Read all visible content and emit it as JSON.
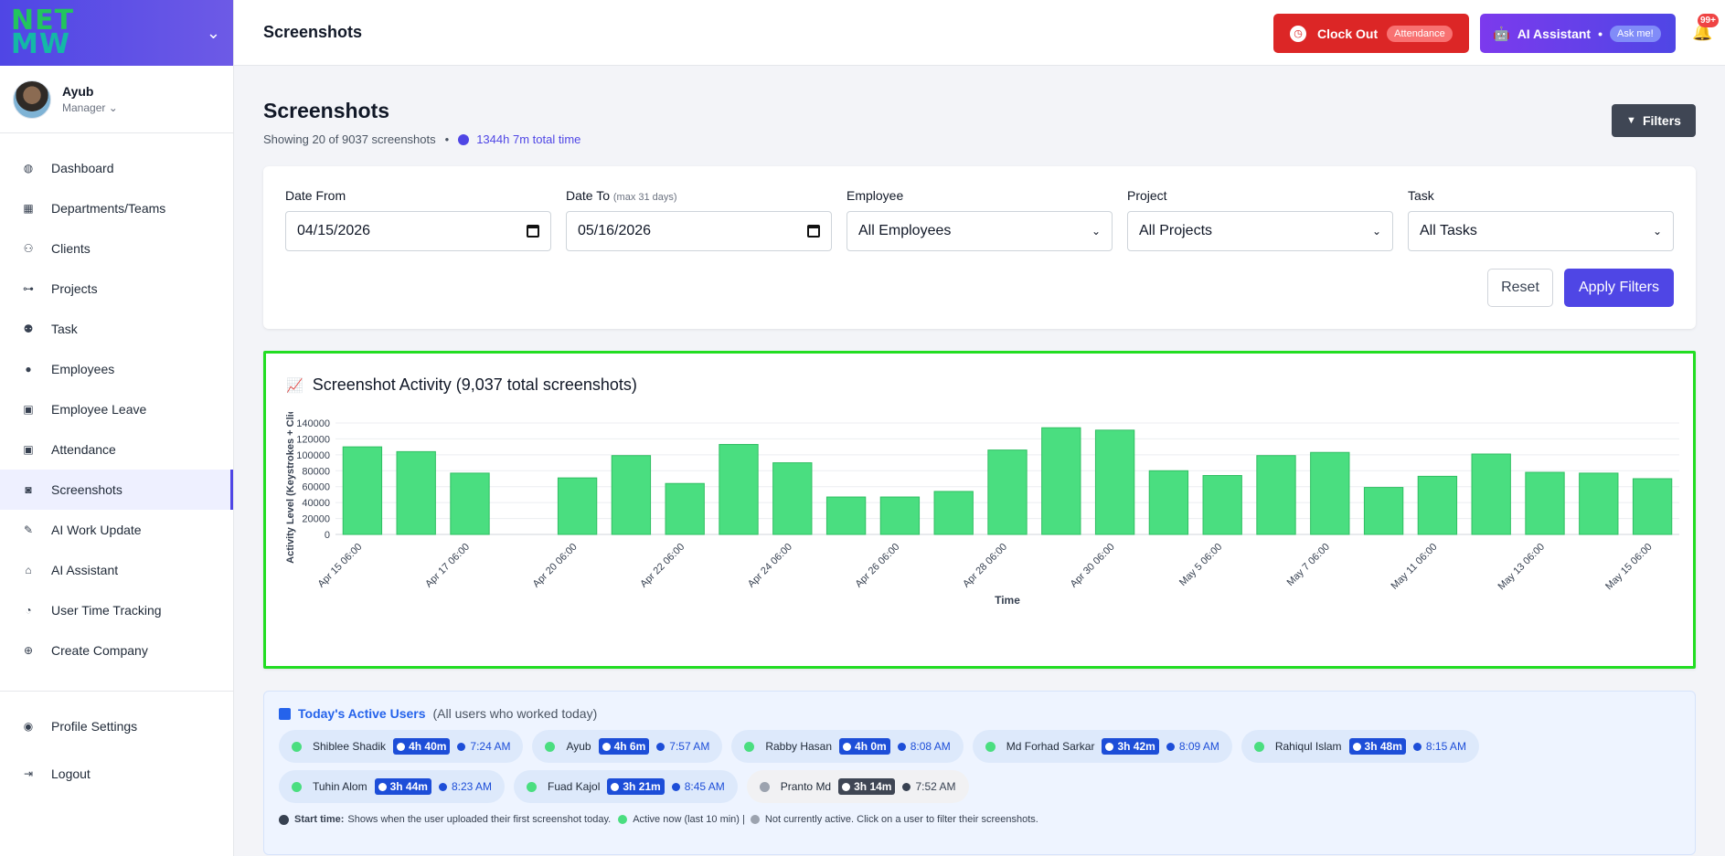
{
  "brand": {
    "logo_line1": "NET",
    "logo_line2": "MW"
  },
  "user": {
    "name": "Ayub",
    "role": "Manager"
  },
  "nav": [
    {
      "label": "Dashboard",
      "icon": "dashboard-icon"
    },
    {
      "label": "Departments/Teams",
      "icon": "building-icon"
    },
    {
      "label": "Clients",
      "icon": "users-icon"
    },
    {
      "label": "Projects",
      "icon": "project-diagram-icon"
    },
    {
      "label": "Task",
      "icon": "people-group-icon"
    },
    {
      "label": "Employees",
      "icon": "user-icon"
    },
    {
      "label": "Employee Leave",
      "icon": "calendar-x-icon"
    },
    {
      "label": "Attendance",
      "icon": "calendar-check-icon"
    },
    {
      "label": "Screenshots",
      "icon": "camera-icon"
    },
    {
      "label": "AI Work Update",
      "icon": "pen-icon"
    },
    {
      "label": "AI Assistant",
      "icon": "robot-icon"
    },
    {
      "label": "User Time Tracking",
      "icon": "user-clock-icon"
    },
    {
      "label": "Create Company",
      "icon": "plus-circle-icon"
    }
  ],
  "nav_bottom": [
    {
      "label": "Profile Settings",
      "icon": "user-circle-icon"
    },
    {
      "label": "Logout",
      "icon": "logout-icon"
    }
  ],
  "topbar": {
    "title": "Screenshots",
    "clock_out": "Clock Out",
    "clock_out_pill": "Attendance",
    "ai_assistant": "AI Assistant",
    "ai_dot": "•",
    "ai_pill": "Ask me!",
    "notification_count": "99+"
  },
  "page": {
    "title": "Screenshots",
    "showing": "Showing 20 of 9037 screenshots",
    "dot": "•",
    "total_time": "1344h 7m total time",
    "filters_button": "Filters"
  },
  "filters": {
    "date_from_label": "Date From",
    "date_from_value": "04/15/2026",
    "date_to_label": "Date To",
    "date_to_hint": "(max 31 days)",
    "date_to_value": "05/16/2026",
    "employee_label": "Employee",
    "employee_value": "All Employees",
    "project_label": "Project",
    "project_value": "All Projects",
    "task_label": "Task",
    "task_value": "All Tasks",
    "reset": "Reset",
    "apply": "Apply Filters"
  },
  "chart_data": {
    "type": "bar",
    "title": "Screenshot Activity (9,037 total screenshots)",
    "xlabel": "Time",
    "ylabel": "Activity Level (Keystrokes + Clic",
    "ylim": [
      0,
      140000
    ],
    "yticks": [
      0,
      20000,
      40000,
      60000,
      80000,
      100000,
      120000,
      140000
    ],
    "bar_color": "#4ade80",
    "categories": [
      "Apr 15 06:00",
      "Apr 16 06:00",
      "Apr 17 06:00",
      "Apr 19 06:00",
      "Apr 20 06:00",
      "Apr 21 06:00",
      "Apr 22 06:00",
      "Apr 23 06:00",
      "Apr 24 06:00",
      "Apr 25 06:00",
      "Apr 26 06:00",
      "Apr 27 06:00",
      "Apr 28 06:00",
      "Apr 29 06:00",
      "Apr 30 06:00",
      "May 4 06:00",
      "May 5 06:00",
      "May 6 06:00",
      "May 7 06:00",
      "May 8 06:00",
      "May 11 06:00",
      "May 12 06:00",
      "May 13 06:00",
      "May 14 06:00",
      "May 15 06:00"
    ],
    "values": [
      110000,
      104000,
      77000,
      null,
      71000,
      99000,
      64000,
      113000,
      90000,
      47000,
      47000,
      54000,
      106000,
      134000,
      131000,
      80000,
      74000,
      99000,
      103000,
      59000,
      73000,
      101000,
      78000,
      77000,
      70000
    ],
    "tick_labels": [
      "Apr 15 06:00",
      "Apr 17 06:00",
      "Apr 20 06:00",
      "Apr 22 06:00",
      "Apr 24 06:00",
      "Apr 26 06:00",
      "Apr 28 06:00",
      "Apr 30 06:00",
      "May 5 06:00",
      "May 7 06:00",
      "May 11 06:00",
      "May 13 06:00",
      "May 15 06:00"
    ],
    "tick_label_index": [
      0,
      2,
      4,
      6,
      8,
      10,
      12,
      14,
      16,
      18,
      20,
      22,
      24
    ]
  },
  "active_users": {
    "title": "Today's Active Users",
    "subtitle": "(All users who worked today)",
    "users": [
      {
        "name": "Shiblee Shadik",
        "duration": "4h 40m",
        "start": "7:24 AM",
        "active": true
      },
      {
        "name": "Ayub",
        "duration": "4h 6m",
        "start": "7:57 AM",
        "active": true
      },
      {
        "name": "Rabby Hasan",
        "duration": "4h 0m",
        "start": "8:08 AM",
        "active": true
      },
      {
        "name": "Md Forhad Sarkar",
        "duration": "3h 42m",
        "start": "8:09 AM",
        "active": true
      },
      {
        "name": "Rahiqul Islam",
        "duration": "3h 48m",
        "start": "8:15 AM",
        "active": true
      },
      {
        "name": "Tuhin Alom",
        "duration": "3h 44m",
        "start": "8:23 AM",
        "active": true
      },
      {
        "name": "Fuad Kajol",
        "duration": "3h 21m",
        "start": "8:45 AM",
        "active": true
      },
      {
        "name": "Pranto Md",
        "duration": "3h 14m",
        "start": "7:52 AM",
        "active": false
      }
    ],
    "legend_start_label": "Start time:",
    "legend_start_text": "Shows when the user uploaded their first screenshot today.",
    "legend_active": "Active now (last 10 min) |",
    "legend_inactive": "Not currently active. Click on a user to filter their screenshots."
  }
}
